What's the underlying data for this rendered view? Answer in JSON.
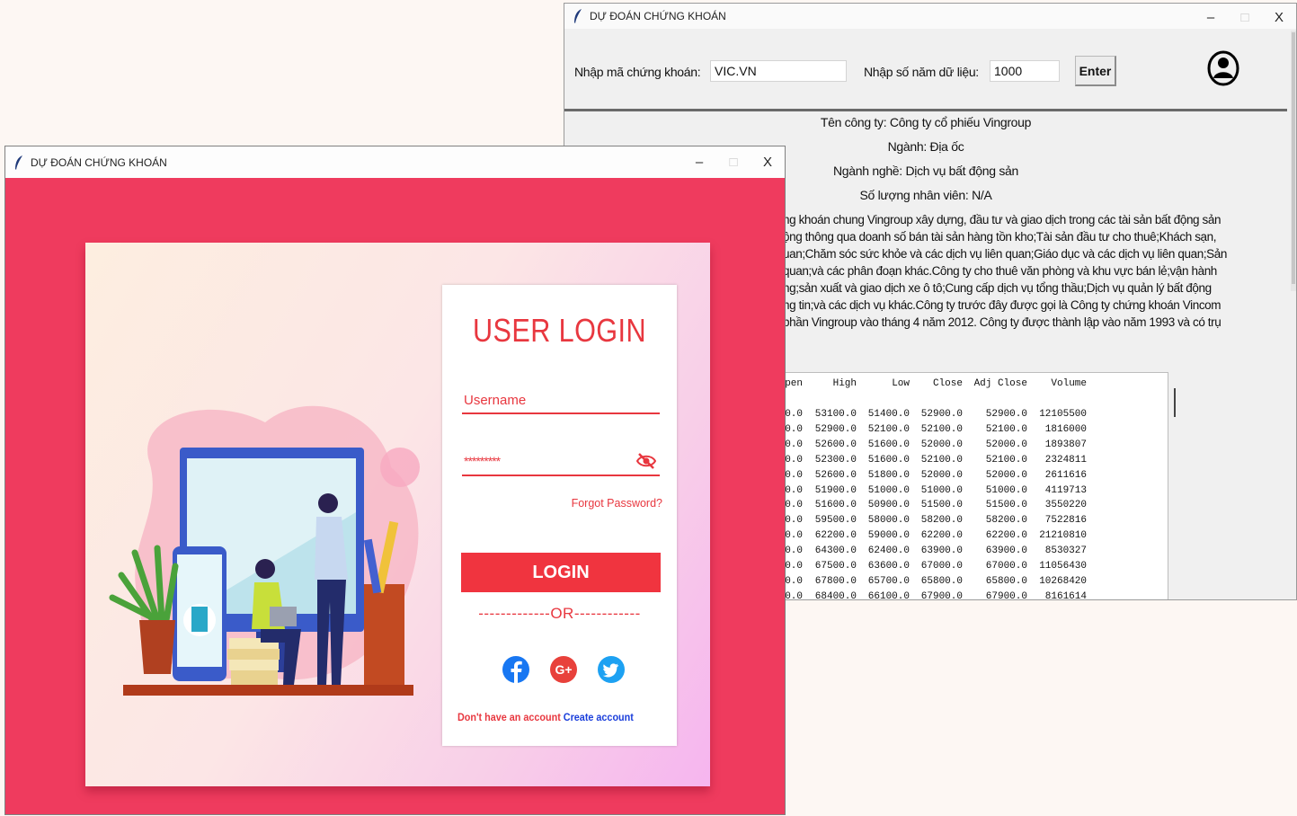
{
  "back_window": {
    "title": "DỰ ĐOÁN CHỨNG KHOÁN",
    "controls": {
      "minimize": "–",
      "maximize": "□",
      "close": "X"
    },
    "stock_label": "Nhập mã chứng khoán:",
    "stock_value": "VIC.VN",
    "years_label": "Nhập số năm dữ liệu:",
    "years_value": "1000",
    "enter_label": "Enter",
    "company": "Tên công ty: Công ty cổ phiếu Vingroup",
    "sector": "Ngành: Địa ốc",
    "industry": "Ngành nghề: Dịch vụ bất động sản",
    "employees": "Số lượng nhân viên: N/A",
    "description_lines": [
      "ng khoán chung Vingroup xây dựng, đầu tư và giao dịch trong các tài sản bất động sản",
      "ộng thông qua doanh số bán tài sản hàng tồn kho;Tài sản đầu tư cho thuê;Khách sạn,",
      "uan;Chăm sóc sức khỏe và các dịch vụ liên quan;Giáo dục và các dịch vụ liên quan;Sản",
      "quan;và các phân đoạn khác.Công ty cho thuê văn phòng và khu vực bán lẻ;vận hành",
      "ng;sản xuất và giao dịch xe ô tô;Cung cấp dịch vụ tổng thầu;Dịch vụ quản lý bất động",
      "ng tin;và các dịch vụ khác.Công ty trước đây được gọi là Công ty chứng khoán Vincom",
      "phần Vingroup vào tháng 4 năm 2012. Công ty được thành lập vào năm 1993 và có trụ"
    ],
    "table": {
      "headers": [
        "pen",
        "High",
        "Low",
        "Close",
        "Adj Close",
        "Volume"
      ],
      "rows": [
        [
          "0.0",
          "53100.0",
          "51400.0",
          "52900.0",
          "52900.0",
          "12105500"
        ],
        [
          "0.0",
          "52900.0",
          "52100.0",
          "52100.0",
          "52100.0",
          "1816000"
        ],
        [
          "0.0",
          "52600.0",
          "51600.0",
          "52000.0",
          "52000.0",
          "1893807"
        ],
        [
          "0.0",
          "52300.0",
          "51600.0",
          "52100.0",
          "52100.0",
          "2324811"
        ],
        [
          "0.0",
          "52600.0",
          "51800.0",
          "52000.0",
          "52000.0",
          "2611616"
        ],
        [
          "0.0",
          "51900.0",
          "51000.0",
          "51000.0",
          "51000.0",
          "4119713"
        ],
        [
          "0.0",
          "51600.0",
          "50900.0",
          "51500.0",
          "51500.0",
          "3550220"
        ],
        [
          "0.0",
          "59500.0",
          "58000.0",
          "58200.0",
          "58200.0",
          "7522816"
        ],
        [
          "0.0",
          "62200.0",
          "59000.0",
          "62200.0",
          "62200.0",
          "21210810"
        ],
        [
          "0.0",
          "64300.0",
          "62400.0",
          "63900.0",
          "63900.0",
          "8530327"
        ],
        [
          "0.0",
          "67500.0",
          "63600.0",
          "67000.0",
          "67000.0",
          "11056430"
        ],
        [
          "0.0",
          "67800.0",
          "65700.0",
          "65800.0",
          "65800.0",
          "10268420"
        ],
        [
          "0.0",
          "68400.0",
          "66100.0",
          "67900.0",
          "67900.0",
          "8161614"
        ]
      ]
    }
  },
  "front_window": {
    "title": "DỰ ĐOÁN CHỨNG KHOÁN",
    "controls": {
      "minimize": "–",
      "maximize": "□",
      "close": "X"
    },
    "login_title": "USER LOGIN",
    "username_placeholder": "Username",
    "password_value": "*********",
    "forgot_label": "Forgot Password?",
    "login_label": "LOGIN",
    "or_text": "-------------OR------------",
    "social": [
      "facebook-icon",
      "google-plus-icon",
      "twitter-icon"
    ],
    "signup_prompt": "Don't have an account",
    "signup_link": "Create account",
    "colors": {
      "accent": "#ef3b5e",
      "button": "#f0343f",
      "link": "#1a3edb"
    }
  }
}
